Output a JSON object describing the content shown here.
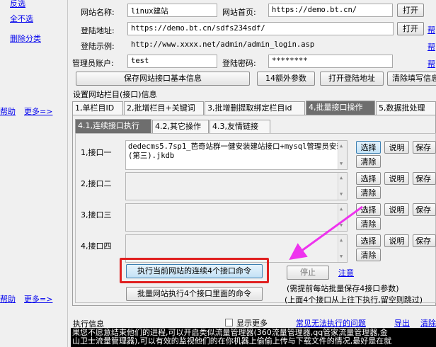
{
  "left_panel": {
    "top_links": [
      "反选",
      "全不选",
      "删除分类"
    ],
    "middle_links": [
      "帮助",
      "更多=>"
    ],
    "bottom_links": [
      "帮助",
      "更多=>"
    ]
  },
  "site_form": {
    "site_name_label": "网站名称:",
    "site_name_value": "linux建站",
    "homepage_label": "网站首页:",
    "homepage_value": "https://demo.bt.cn/",
    "open_label": "打开",
    "login_url_label": "登陆地址:",
    "login_url_value": "https://demo.bt.cn/sdfs234sdf/",
    "open_label_2": "打开",
    "login_example_label": "登陆示例:",
    "login_example_value": "http://www.xxxx.net/admin/admin_login.asp",
    "admin_account_label": "管理员账户:",
    "admin_account_value": "test",
    "password_label": "登陆密码:",
    "password_value": "********",
    "help_links": [
      "帮",
      "帮",
      "帮"
    ]
  },
  "action_buttons": {
    "save_interface": "保存网站接口基本信息",
    "extra_params": "14额外参数",
    "open_login": "打开登陆地址",
    "clear_fill": "清除填写信息"
  },
  "section_title": "设置网站栏目(接口)信息",
  "main_tabs": [
    "1,单栏目ID",
    "2,批增栏目+关键词",
    "3,批增删提取绑定栏目id",
    "4,批量接口操作",
    "5,数据批处理"
  ],
  "sub_tabs": [
    "4.1,连续接口执行",
    "4.2,其它操作",
    "4.3,友情链接"
  ],
  "interfaces": [
    {
      "label": "1,接口一",
      "value": "dedecms5.7sp1_芭奇站群一健安装建站接口+mysql管理员安装(第三).jkdb"
    },
    {
      "label": "2,接口二",
      "value": ""
    },
    {
      "label": "3,接口三",
      "value": ""
    },
    {
      "label": "4,接口四",
      "value": ""
    }
  ],
  "row_buttons": {
    "select": "选择",
    "explain": "说明",
    "save": "保存",
    "clear": "清除"
  },
  "execute": {
    "run_current": "执行当前网站的连续4个接口命令",
    "stop": "停止",
    "note": "注意",
    "batch_run": "批量网站执行4个接口里面的命令",
    "hint1": "(需提前每站批量保存4接口参数)",
    "hint2": "(上面4个接口从上往下执行,留空则跳过)"
  },
  "log_bar": {
    "title": "执行信息",
    "show_more": "显示更多",
    "problem_link": "常见无法执行的问题",
    "export": "导出",
    "clear": "清除"
  },
  "log_lines": [
    "果您不愿意结束他们的进程,可以开启类似流量管理器(360流量管理器,qq管家流量管理器,金",
    "山卫士流量管理器),可以有效的监视他们的在你机器上偷偷上传与下载文件的情况,最好是在就"
  ],
  "colors": {
    "highlight_box": "#e02020",
    "arrow": "#ee33ee",
    "active_tab": "#6e6e6e"
  }
}
